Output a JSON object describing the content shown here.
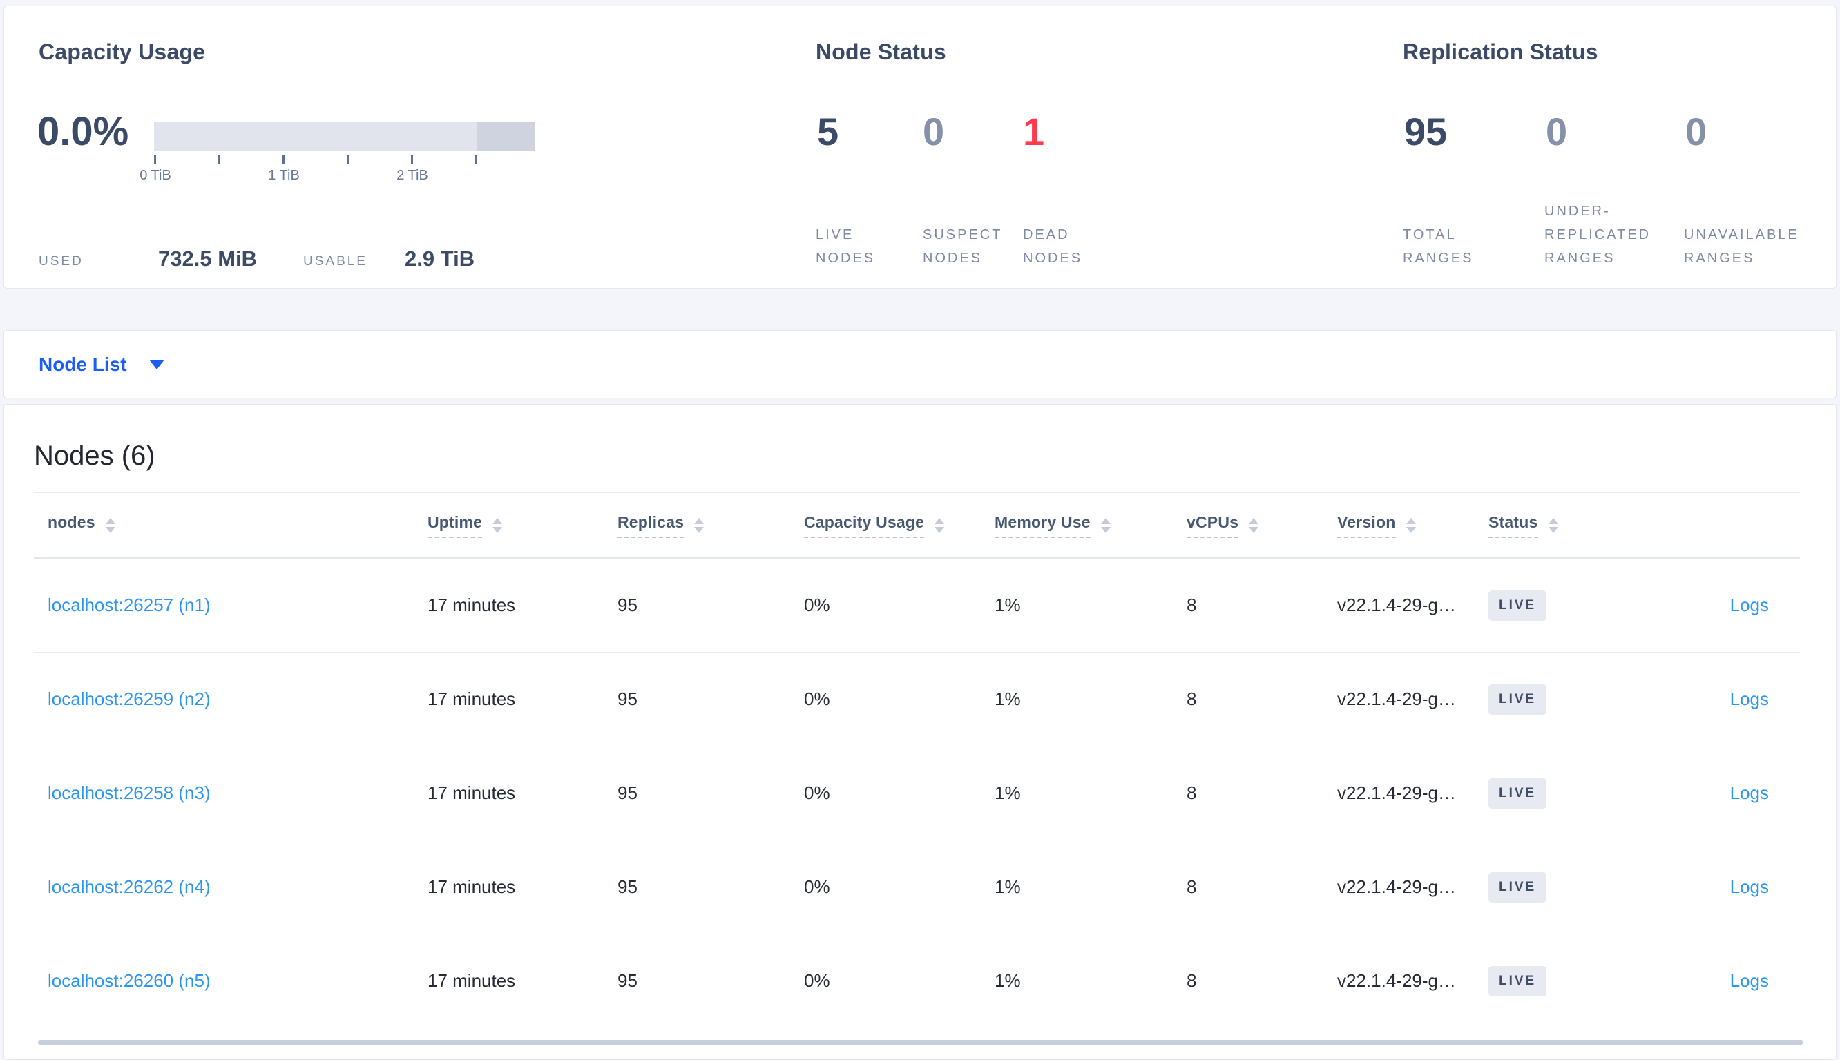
{
  "capacity": {
    "title": "Capacity Usage",
    "percent": "0.0%",
    "tick_labels": [
      "0 TiB",
      "1 TiB",
      "2 TiB"
    ],
    "used_label": "USED",
    "used_value": "732.5 MiB",
    "usable_label": "USABLE",
    "usable_value": "2.9 TiB"
  },
  "node_status": {
    "title": "Node Status",
    "live": {
      "value": "5",
      "line1": "LIVE",
      "line2": "NODES"
    },
    "suspect": {
      "value": "0",
      "line1": "SUSPECT",
      "line2": "NODES"
    },
    "dead": {
      "value": "1",
      "line1": "DEAD",
      "line2": "NODES"
    }
  },
  "replication": {
    "title": "Replication Status",
    "total": {
      "value": "95",
      "line1": "TOTAL",
      "line2": "RANGES"
    },
    "under": {
      "value": "0",
      "line1": "UNDER-",
      "line2": "REPLICATED",
      "line3": "RANGES"
    },
    "unavailable": {
      "value": "0",
      "line1": "UNAVAILABLE",
      "line2": "RANGES"
    }
  },
  "view_selector": {
    "label": "Node List"
  },
  "nodes": {
    "title": "Nodes (6)",
    "columns": {
      "nodes": "nodes",
      "uptime": "Uptime",
      "replicas": "Replicas",
      "capacity": "Capacity Usage",
      "memory": "Memory Use",
      "vcpus": "vCPUs",
      "version": "Version",
      "status": "Status"
    },
    "rows": [
      {
        "node": "localhost:26257 (n1)",
        "uptime": "17 minutes",
        "replicas": "95",
        "capacity": "0%",
        "memory": "1%",
        "vcpus": "8",
        "version": "v22.1.4-29-g…",
        "status": "LIVE",
        "logs": "Logs"
      },
      {
        "node": "localhost:26259 (n2)",
        "uptime": "17 minutes",
        "replicas": "95",
        "capacity": "0%",
        "memory": "1%",
        "vcpus": "8",
        "version": "v22.1.4-29-g…",
        "status": "LIVE",
        "logs": "Logs"
      },
      {
        "node": "localhost:26258 (n3)",
        "uptime": "17 minutes",
        "replicas": "95",
        "capacity": "0%",
        "memory": "1%",
        "vcpus": "8",
        "version": "v22.1.4-29-g…",
        "status": "LIVE",
        "logs": "Logs"
      },
      {
        "node": "localhost:26262 (n4)",
        "uptime": "17 minutes",
        "replicas": "95",
        "capacity": "0%",
        "memory": "1%",
        "vcpus": "8",
        "version": "v22.1.4-29-g…",
        "status": "LIVE",
        "logs": "Logs"
      },
      {
        "node": "localhost:26260 (n5)",
        "uptime": "17 minutes",
        "replicas": "95",
        "capacity": "0%",
        "memory": "1%",
        "vcpus": "8",
        "version": "v22.1.4-29-g…",
        "status": "LIVE",
        "logs": "Logs"
      }
    ]
  },
  "colors": {
    "accent_blue": "#1a5ef5",
    "link_blue": "#2d96f5",
    "danger_red": "#fc3b4e",
    "bar_light": "#e2e4ed",
    "bar_dark": "#cfd3df"
  }
}
